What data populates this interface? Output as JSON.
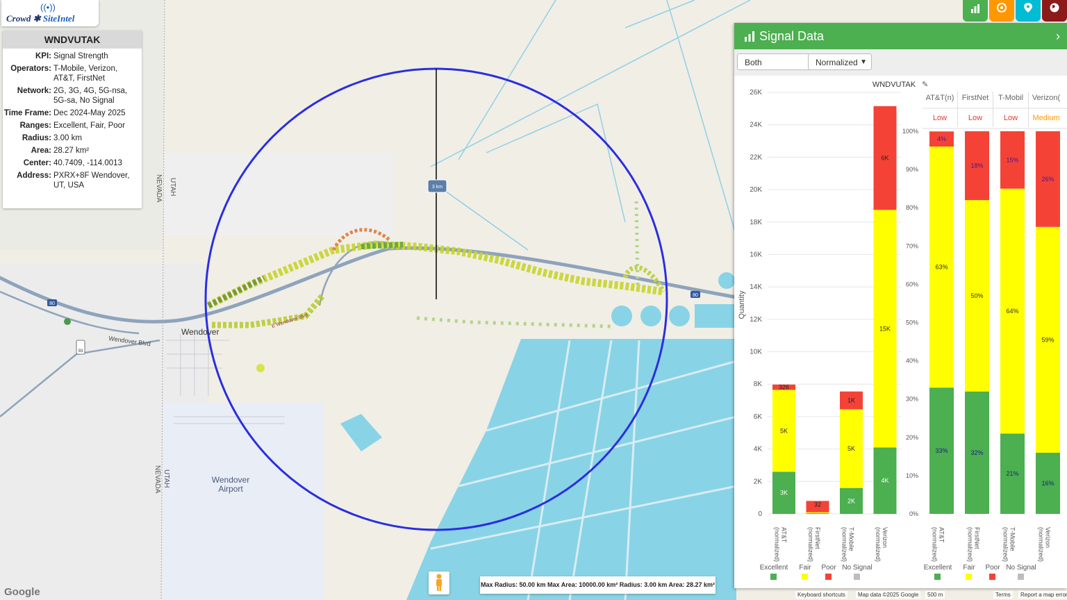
{
  "app": {
    "logo_left": "Crowd",
    "logo_right": "SiteIntel",
    "logo_icon": "antenna-icon"
  },
  "info": {
    "title": "WNDVUTAK",
    "rows": [
      {
        "k": "KPI:",
        "v": "Signal Strength"
      },
      {
        "k": "Operators:",
        "v": "T-Mobile, Verizon, AT&T, FirstNet"
      },
      {
        "k": "Network:",
        "v": "2G, 3G, 4G, 5G-nsa, 5G-sa, No Signal"
      },
      {
        "k": "Time Frame:",
        "v": "Dec 2024-May 2025"
      },
      {
        "k": "Ranges:",
        "v": "Excellent, Fair, Poor"
      },
      {
        "k": "Radius:",
        "v": "3.00 km"
      },
      {
        "k": "Area:",
        "v": "28.27 km²"
      },
      {
        "k": "Center:",
        "v": "40.7409, -114.0013"
      },
      {
        "k": "Address:",
        "v": "PXRX+8F Wendover, UT, USA"
      }
    ]
  },
  "map": {
    "labels": {
      "town": "Wendover",
      "airport": "Wendover Airport",
      "road": "Wendover Blvd",
      "road2": "E Wendover Blvd",
      "utah": "UTAH",
      "nevada": "NEVADA",
      "hwy": "80",
      "alt": "ALT 93",
      "radius_tag": "3 km"
    },
    "scale_text": "Max Radius: 50.00 km Max Area: 10000.00 km² Radius: 3.00 km Area: 28.27 km²",
    "footer": {
      "google": "Google",
      "shortcuts": "Keyboard shortcuts",
      "mapdata": "Map data ©2025 Google",
      "scale": "500 m",
      "terms": "Terms",
      "report": "Report a map error"
    }
  },
  "top_buttons": [
    {
      "icon": "bar-chart-icon",
      "color": "#4caf50"
    },
    {
      "icon": "target-icon",
      "color": "#ff9800"
    },
    {
      "icon": "map-pin-icon",
      "color": "#00bcd4"
    },
    {
      "icon": "globe-icon",
      "color": "#8b0000"
    }
  ],
  "panel": {
    "title": "Signal Data",
    "select1": "Both",
    "select2": "Normalized",
    "chart_title": "WNDVUTAK",
    "ylabel": "Quantity",
    "quality": [
      {
        "op": "AT&T",
        "sup": "(n)",
        "level": "Low",
        "color": "#e53935"
      },
      {
        "op": "FirstNet",
        "sup": "",
        "level": "Low",
        "color": "#e53935"
      },
      {
        "op": "T-Mobil",
        "sup": "",
        "level": "Low",
        "color": "#e53935"
      },
      {
        "op": "Verizon",
        "sup": "(",
        "level": "Medium",
        "color": "#ff9800"
      }
    ],
    "legend": [
      "Excellent",
      "Fair",
      "Poor",
      "No Signal"
    ],
    "legend_colors": [
      "#4caf50",
      "#ffff00",
      "#f44336",
      "#bdbdbd"
    ]
  },
  "chart_data": [
    {
      "type": "bar",
      "stacked": true,
      "title": "WNDVUTAK",
      "ylabel": "Quantity",
      "ylim": [
        0,
        26000
      ],
      "yticks": [
        "0",
        "2K",
        "4K",
        "6K",
        "8K",
        "10K",
        "12K",
        "14K",
        "16K",
        "18K",
        "20K",
        "22K",
        "24K",
        "26K"
      ],
      "categories": [
        "AT&T (normalized)",
        "FirstNet (normalized)",
        "T-Mobile (normalized)",
        "Verizon (normalized)"
      ],
      "series": [
        {
          "name": "Excellent",
          "values": [
            2600,
            40,
            1600,
            4100
          ],
          "labels": [
            "3K",
            "",
            "2K",
            "4K"
          ]
        },
        {
          "name": "Fair",
          "values": [
            5050,
            60,
            4850,
            14650
          ],
          "labels": [
            "5K",
            "",
            "5K",
            "15K"
          ]
        },
        {
          "name": "Poor",
          "values": [
            326,
            700,
            1100,
            6400
          ],
          "labels": [
            "326",
            "32",
            "1K",
            "6K"
          ]
        }
      ]
    },
    {
      "type": "bar",
      "stacked": true,
      "ylim": [
        0,
        100
      ],
      "yticks": [
        "0%",
        "10%",
        "20%",
        "30%",
        "40%",
        "50%",
        "60%",
        "70%",
        "80%",
        "90%",
        "100%"
      ],
      "categories": [
        "AT&T (normalized)",
        "FirstNet (normalized)",
        "T-Mobile (normalized)",
        "Verizon (normalized)"
      ],
      "series": [
        {
          "name": "Excellent",
          "values": [
            33,
            32,
            21,
            16
          ],
          "labels": [
            "33%",
            "32%",
            "21%",
            "16%"
          ]
        },
        {
          "name": "Fair",
          "values": [
            63,
            50,
            64,
            59
          ],
          "labels": [
            "63%",
            "50%",
            "64%",
            "59%"
          ]
        },
        {
          "name": "Poor",
          "values": [
            4,
            18,
            15,
            26
          ],
          "labels": [
            "4%",
            "18%",
            "15%",
            "26%"
          ]
        },
        {
          "name": "No Signal",
          "values": [
            1,
            0,
            0,
            0
          ],
          "labels": [
            "",
            "",
            "",
            ""
          ]
        }
      ]
    }
  ]
}
